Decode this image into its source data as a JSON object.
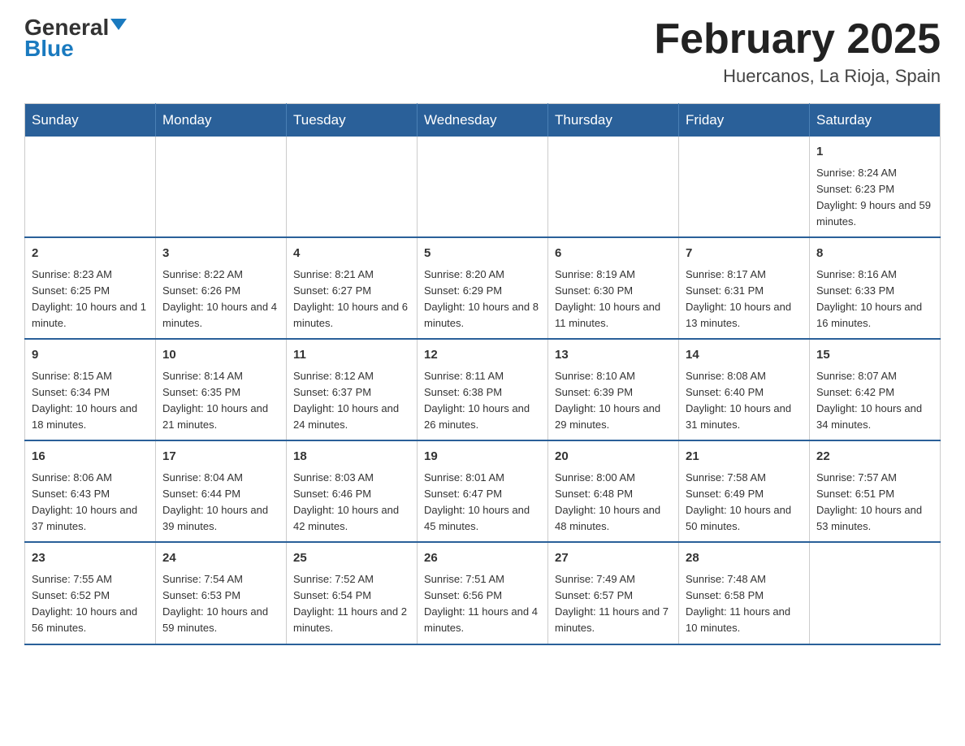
{
  "header": {
    "logo_general": "General",
    "logo_blue": "Blue",
    "month_title": "February 2025",
    "location": "Huercanos, La Rioja, Spain"
  },
  "days_of_week": [
    "Sunday",
    "Monday",
    "Tuesday",
    "Wednesday",
    "Thursday",
    "Friday",
    "Saturday"
  ],
  "weeks": [
    [
      {
        "day": "",
        "info": ""
      },
      {
        "day": "",
        "info": ""
      },
      {
        "day": "",
        "info": ""
      },
      {
        "day": "",
        "info": ""
      },
      {
        "day": "",
        "info": ""
      },
      {
        "day": "",
        "info": ""
      },
      {
        "day": "1",
        "info": "Sunrise: 8:24 AM\nSunset: 6:23 PM\nDaylight: 9 hours and 59 minutes."
      }
    ],
    [
      {
        "day": "2",
        "info": "Sunrise: 8:23 AM\nSunset: 6:25 PM\nDaylight: 10 hours and 1 minute."
      },
      {
        "day": "3",
        "info": "Sunrise: 8:22 AM\nSunset: 6:26 PM\nDaylight: 10 hours and 4 minutes."
      },
      {
        "day": "4",
        "info": "Sunrise: 8:21 AM\nSunset: 6:27 PM\nDaylight: 10 hours and 6 minutes."
      },
      {
        "day": "5",
        "info": "Sunrise: 8:20 AM\nSunset: 6:29 PM\nDaylight: 10 hours and 8 minutes."
      },
      {
        "day": "6",
        "info": "Sunrise: 8:19 AM\nSunset: 6:30 PM\nDaylight: 10 hours and 11 minutes."
      },
      {
        "day": "7",
        "info": "Sunrise: 8:17 AM\nSunset: 6:31 PM\nDaylight: 10 hours and 13 minutes."
      },
      {
        "day": "8",
        "info": "Sunrise: 8:16 AM\nSunset: 6:33 PM\nDaylight: 10 hours and 16 minutes."
      }
    ],
    [
      {
        "day": "9",
        "info": "Sunrise: 8:15 AM\nSunset: 6:34 PM\nDaylight: 10 hours and 18 minutes."
      },
      {
        "day": "10",
        "info": "Sunrise: 8:14 AM\nSunset: 6:35 PM\nDaylight: 10 hours and 21 minutes."
      },
      {
        "day": "11",
        "info": "Sunrise: 8:12 AM\nSunset: 6:37 PM\nDaylight: 10 hours and 24 minutes."
      },
      {
        "day": "12",
        "info": "Sunrise: 8:11 AM\nSunset: 6:38 PM\nDaylight: 10 hours and 26 minutes."
      },
      {
        "day": "13",
        "info": "Sunrise: 8:10 AM\nSunset: 6:39 PM\nDaylight: 10 hours and 29 minutes."
      },
      {
        "day": "14",
        "info": "Sunrise: 8:08 AM\nSunset: 6:40 PM\nDaylight: 10 hours and 31 minutes."
      },
      {
        "day": "15",
        "info": "Sunrise: 8:07 AM\nSunset: 6:42 PM\nDaylight: 10 hours and 34 minutes."
      }
    ],
    [
      {
        "day": "16",
        "info": "Sunrise: 8:06 AM\nSunset: 6:43 PM\nDaylight: 10 hours and 37 minutes."
      },
      {
        "day": "17",
        "info": "Sunrise: 8:04 AM\nSunset: 6:44 PM\nDaylight: 10 hours and 39 minutes."
      },
      {
        "day": "18",
        "info": "Sunrise: 8:03 AM\nSunset: 6:46 PM\nDaylight: 10 hours and 42 minutes."
      },
      {
        "day": "19",
        "info": "Sunrise: 8:01 AM\nSunset: 6:47 PM\nDaylight: 10 hours and 45 minutes."
      },
      {
        "day": "20",
        "info": "Sunrise: 8:00 AM\nSunset: 6:48 PM\nDaylight: 10 hours and 48 minutes."
      },
      {
        "day": "21",
        "info": "Sunrise: 7:58 AM\nSunset: 6:49 PM\nDaylight: 10 hours and 50 minutes."
      },
      {
        "day": "22",
        "info": "Sunrise: 7:57 AM\nSunset: 6:51 PM\nDaylight: 10 hours and 53 minutes."
      }
    ],
    [
      {
        "day": "23",
        "info": "Sunrise: 7:55 AM\nSunset: 6:52 PM\nDaylight: 10 hours and 56 minutes."
      },
      {
        "day": "24",
        "info": "Sunrise: 7:54 AM\nSunset: 6:53 PM\nDaylight: 10 hours and 59 minutes."
      },
      {
        "day": "25",
        "info": "Sunrise: 7:52 AM\nSunset: 6:54 PM\nDaylight: 11 hours and 2 minutes."
      },
      {
        "day": "26",
        "info": "Sunrise: 7:51 AM\nSunset: 6:56 PM\nDaylight: 11 hours and 4 minutes."
      },
      {
        "day": "27",
        "info": "Sunrise: 7:49 AM\nSunset: 6:57 PM\nDaylight: 11 hours and 7 minutes."
      },
      {
        "day": "28",
        "info": "Sunrise: 7:48 AM\nSunset: 6:58 PM\nDaylight: 11 hours and 10 minutes."
      },
      {
        "day": "",
        "info": ""
      }
    ]
  ]
}
